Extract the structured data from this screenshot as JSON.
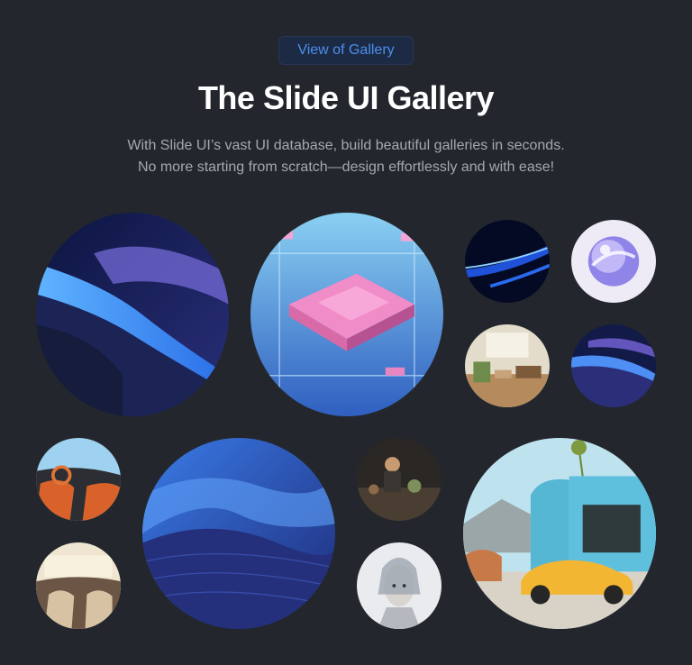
{
  "header": {
    "badge_label": "View of Gallery",
    "title": "The Slide UI Gallery",
    "subtitle_line1": "With Slide UI’s vast UI database, build beautiful galleries in seconds.",
    "subtitle_line2": "No more starting from scratch—design effortlessly and with ease!"
  },
  "gallery": {
    "items": [
      {
        "subject": "blue-abstract-waves"
      },
      {
        "subject": "circuit-chip"
      },
      {
        "subject": "blue-light-streaks"
      },
      {
        "subject": "glass-sphere"
      },
      {
        "subject": "cozy-interior"
      },
      {
        "subject": "blue-purple-waves"
      },
      {
        "subject": "car-interior-orange"
      },
      {
        "subject": "blue-sand-dunes"
      },
      {
        "subject": "artisan-workshop"
      },
      {
        "subject": "sports-car-house"
      },
      {
        "subject": "car-interior-beige"
      },
      {
        "subject": "cyborg-woman"
      }
    ]
  }
}
